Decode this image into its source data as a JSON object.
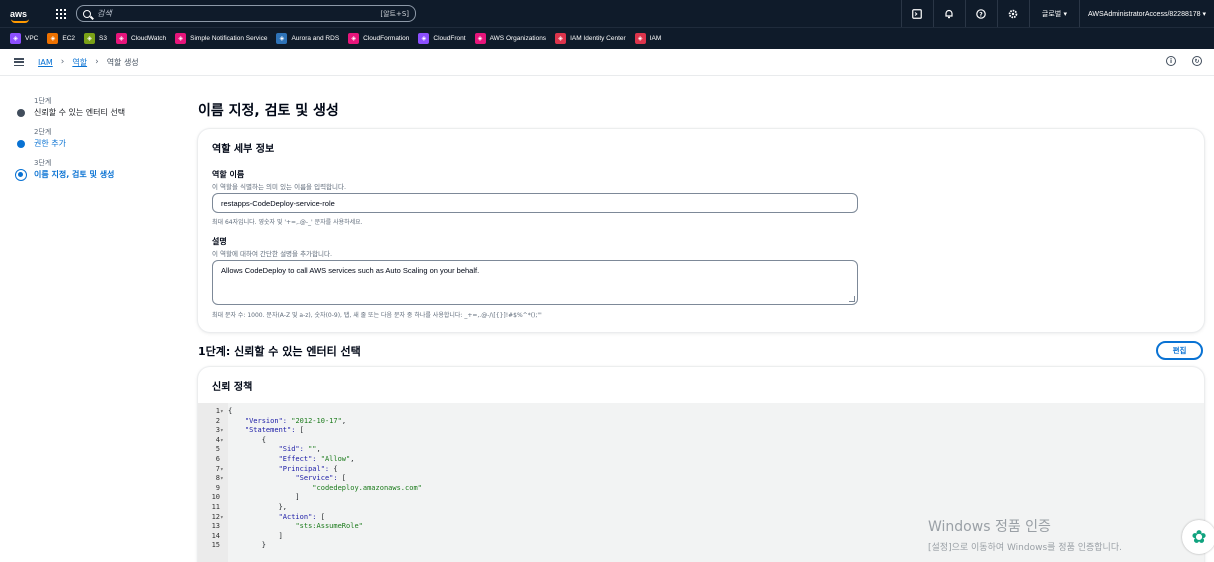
{
  "topnav": {
    "logo": "aws",
    "search_placeholder": "검색",
    "search_shortcut": "[알트+S]",
    "icons": [
      "cloudshell-icon",
      "bell-icon",
      "help-icon",
      "gear-icon"
    ],
    "region": "글로벌 ▾",
    "account": "AWSAdministratorAccess/82288178 ▾"
  },
  "favorites": [
    {
      "label": "VPC",
      "color": "#8c4fff"
    },
    {
      "label": "EC2",
      "color": "#ed7100"
    },
    {
      "label": "S3",
      "color": "#7aa116"
    },
    {
      "label": "CloudWatch",
      "color": "#e7157b"
    },
    {
      "label": "Simple Notification Service",
      "color": "#e7157b"
    },
    {
      "label": "Aurora and RDS",
      "color": "#2e73b8"
    },
    {
      "label": "CloudFormation",
      "color": "#e7157b"
    },
    {
      "label": "CloudFront",
      "color": "#8c4fff"
    },
    {
      "label": "AWS Organizations",
      "color": "#e7157b"
    },
    {
      "label": "IAM Identity Center",
      "color": "#dd344c"
    },
    {
      "label": "IAM",
      "color": "#dd344c"
    }
  ],
  "breadcrumb": {
    "items": [
      "IAM",
      "역할"
    ],
    "current": "역할 생성"
  },
  "steps": [
    {
      "num": "1단계",
      "label": "신뢰할 수 있는 엔터티 선택"
    },
    {
      "num": "2단계",
      "label": "권한 추가"
    },
    {
      "num": "3단계",
      "label": "이름 지정, 검토 및 생성"
    }
  ],
  "page_title": "이름 지정, 검토 및 생성",
  "role_details": {
    "title": "역할 세부 정보",
    "name_label": "역할 이름",
    "name_desc": "이 역할을 식별하는 의미 있는 이름을 입력합니다.",
    "name_value": "restapps-CodeDeploy-service-role",
    "name_constraint": "최대 64자입니다. 영숫자 및 '+=,.@-_' 문자를 사용하세요.",
    "desc_label": "설명",
    "desc_desc": "이 역할에 대하여 간단한 설명을 추가합니다.",
    "desc_value": "Allows CodeDeploy to call AWS services such as Auto Scaling on your behalf.",
    "desc_constraint": "최대 문자 수: 1000. 문자(A-Z 및 a-z), 숫자(0-9), 탭, 새 줄 또는 다음 문자 중 하나를 사용합니다: _+=,.@-/\\[{}]!#$%^*();'\""
  },
  "step1_section": {
    "heading": "1단계: 신뢰할 수 있는 엔터티 선택",
    "edit_label": "편집",
    "trust_title": "신뢰 정책"
  },
  "code_lines": [
    {
      "n": "1",
      "fold": "▾",
      "text": "{"
    },
    {
      "n": "2",
      "fold": "",
      "text": "    \"Version\": \"2012-10-17\","
    },
    {
      "n": "3",
      "fold": "▾",
      "text": "    \"Statement\": ["
    },
    {
      "n": "4",
      "fold": "▾",
      "text": "        {"
    },
    {
      "n": "5",
      "fold": "",
      "text": "            \"Sid\": \"\","
    },
    {
      "n": "6",
      "fold": "",
      "text": "            \"Effect\": \"Allow\","
    },
    {
      "n": "7",
      "fold": "▾",
      "text": "            \"Principal\": {"
    },
    {
      "n": "8",
      "fold": "▾",
      "text": "                \"Service\": ["
    },
    {
      "n": "9",
      "fold": "",
      "text": "                    \"codedeploy.amazonaws.com\""
    },
    {
      "n": "10",
      "fold": "",
      "text": "                ]"
    },
    {
      "n": "11",
      "fold": "",
      "text": "            },"
    },
    {
      "n": "12",
      "fold": "▾",
      "text": "            \"Action\": ["
    },
    {
      "n": "13",
      "fold": "",
      "text": "                \"sts:AssumeRole\""
    },
    {
      "n": "14",
      "fold": "",
      "text": "            ]"
    },
    {
      "n": "15",
      "fold": "",
      "text": "        }"
    }
  ],
  "watermark": {
    "line1": "Windows 정품 인증",
    "line2": "[설정]으로 이동하여 Windows를 정품 인증합니다."
  }
}
